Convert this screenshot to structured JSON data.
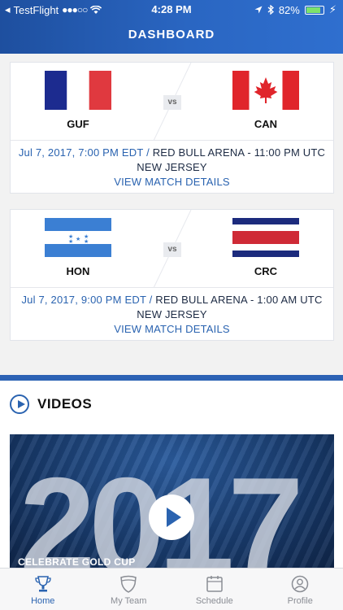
{
  "status_bar": {
    "carrier": "TestFlight",
    "signal": "●●●○○",
    "time": "4:28 PM",
    "battery": "82%",
    "battery_level": 0.82
  },
  "nav": {
    "title": "DASHBOARD"
  },
  "matches": [
    {
      "home_code": "GUF",
      "away_code": "CAN",
      "vs": "vs",
      "date": "Jul 7, 2017, 7:00 PM EDT /",
      "venue": "RED BULL ARENA - 11:00 PM UTC NEW JERSEY",
      "details_link": "VIEW MATCH DETAILS"
    },
    {
      "home_code": "HON",
      "away_code": "CRC",
      "vs": "vs",
      "date": "Jul 7, 2017, 9:00 PM EDT /",
      "venue": "RED BULL ARENA - 1:00 AM UTC NEW JERSEY",
      "details_link": "VIEW MATCH DETAILS"
    }
  ],
  "videos": {
    "title": "VIDEOS",
    "featured": {
      "year_text": "2017",
      "caption": "CELEBRATE GOLD CUP"
    }
  },
  "tabs": [
    {
      "label": "Home",
      "icon": "trophy-icon",
      "active": true
    },
    {
      "label": "My Team",
      "icon": "shield-icon",
      "active": false
    },
    {
      "label": "Schedule",
      "icon": "calendar-icon",
      "active": false
    },
    {
      "label": "Profile",
      "icon": "user-icon",
      "active": false
    }
  ],
  "colors": {
    "brand_blue": "#2a63b0",
    "nav_blue": "#1e4f9f"
  }
}
